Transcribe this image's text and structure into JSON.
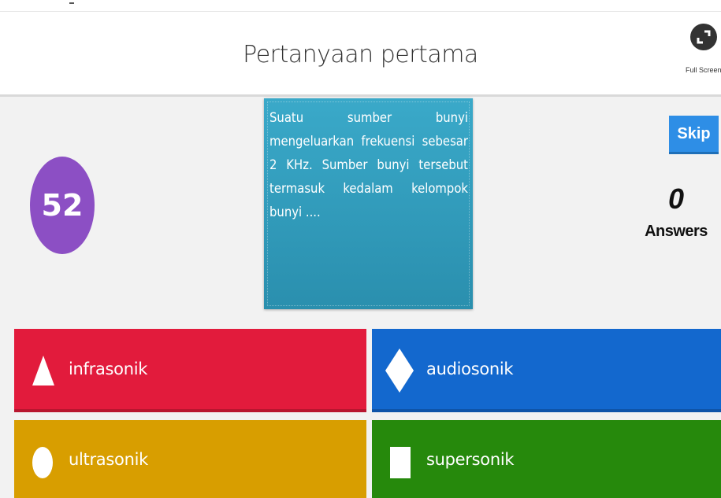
{
  "header": {
    "title": "Pertanyaan pertama",
    "fullscreen_label": "Full Screen"
  },
  "timer": {
    "value": "52"
  },
  "question": {
    "text": "Suatu sumber bunyi mengeluarkan frekuensi sebesar 2 KHz. Sumber bunyi tersebut termasuk kedalam kelompok bunyi ...."
  },
  "controls": {
    "skip_label": "Skip",
    "answers_count": "0",
    "answers_label": "Answers"
  },
  "answers": [
    {
      "label": "infrasonik",
      "shape": "triangle-icon",
      "color": "#e21b3c"
    },
    {
      "label": "audiosonik",
      "shape": "diamond-icon",
      "color": "#1368ce"
    },
    {
      "label": "ultrasonik",
      "shape": "circle-icon",
      "color": "#d89e00"
    },
    {
      "label": "supersonik",
      "shape": "square-icon",
      "color": "#26890c"
    }
  ],
  "colors": {
    "timer": "#8c4fc4",
    "question_card": "#3aa9c9",
    "skip_button": "#2e8ee6"
  }
}
